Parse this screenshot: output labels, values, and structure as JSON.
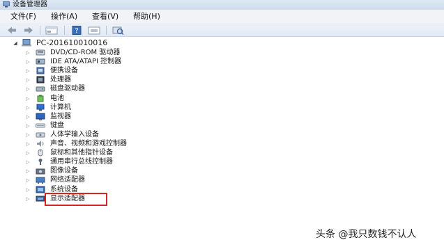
{
  "window": {
    "title": "设备管理器"
  },
  "menu": [
    "文件(F)",
    "操作(A)",
    "查看(V)",
    "帮助(H)"
  ],
  "toolbar_icons": [
    "back-arrow-icon",
    "forward-arrow-icon",
    "properties-icon",
    "help-icon",
    "update-driver-icon",
    "scan-hardware-icon"
  ],
  "tree": {
    "root": "PC-201610010016",
    "items": [
      {
        "label": "DVD/CD-ROM 驱动器",
        "icon": "dvd-drive-icon"
      },
      {
        "label": "IDE ATA/ATAPI 控制器",
        "icon": "ide-controller-icon"
      },
      {
        "label": "便携设备",
        "icon": "portable-device-icon"
      },
      {
        "label": "处理器",
        "icon": "processor-icon"
      },
      {
        "label": "磁盘驱动器",
        "icon": "disk-drive-icon"
      },
      {
        "label": "电池",
        "icon": "battery-icon"
      },
      {
        "label": "计算机",
        "icon": "computer-icon"
      },
      {
        "label": "监视器",
        "icon": "monitor-icon"
      },
      {
        "label": "键盘",
        "icon": "keyboard-icon"
      },
      {
        "label": "人体学输入设备",
        "icon": "hid-icon"
      },
      {
        "label": "声音、视频和游戏控制器",
        "icon": "speaker-icon"
      },
      {
        "label": "鼠标和其他指针设备",
        "icon": "mouse-icon"
      },
      {
        "label": "通用串行总线控制器",
        "icon": "usb-icon"
      },
      {
        "label": "图像设备",
        "icon": "camera-icon"
      },
      {
        "label": "网络适配器",
        "icon": "network-adapter-icon"
      },
      {
        "label": "系统设备",
        "icon": "system-device-icon"
      },
      {
        "label": "显示适配器",
        "icon": "display-adapter-icon"
      }
    ]
  },
  "watermark": "头条 @我只数钱不认人",
  "colors": {
    "highlight": "#d62424",
    "toolbar": "#e1e9f4",
    "menubar": "#f1f3f7"
  }
}
